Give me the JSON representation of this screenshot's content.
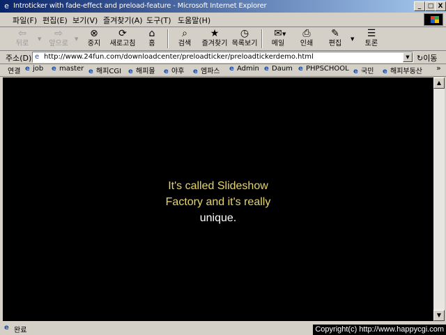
{
  "window": {
    "title": "Introticker with fade-effect and preload-feature - Microsoft Internet Explorer",
    "icon": "ie-icon",
    "minimize_label": "_",
    "maximize_label": "□",
    "close_label": "X"
  },
  "menu": [
    "파일(F)",
    "편집(E)",
    "보기(V)",
    "즐겨찾기(A)",
    "도구(T)",
    "도움말(H)"
  ],
  "toolbar": {
    "back": "뒤로",
    "forward": "앞으로",
    "stop": "중지",
    "refresh": "새로고침",
    "home": "홈",
    "search": "검색",
    "favorites": "즐겨찾기",
    "history": "목록보기",
    "mail": "메일",
    "print": "인쇄",
    "edit": "편집",
    "discuss": "토론"
  },
  "address": {
    "label": "주소(D)",
    "url": "http://www.24fun.com/downloadcenter/preloadticker/preloadtickerdemo.html",
    "go_label": "이동"
  },
  "links": {
    "label": "연결",
    "items": [
      "job",
      "master",
      "해피CGI",
      "해피몰",
      "야후",
      "엠파스",
      "Admin",
      "Daum",
      "PHPSCHOOL",
      "국민",
      "해피부동산"
    ],
    "more": "»"
  },
  "content": {
    "line1": "It's called Slideshow",
    "line2": "Factory and it's really",
    "line3": "unique."
  },
  "colors": {
    "title_start": "#0a246a",
    "title_end": "#a6caf0",
    "content_bg": "#000000",
    "text_yellow": "#e4d66a",
    "text_white": "#ffffff"
  },
  "status": {
    "text": "완료"
  },
  "watermark": "Copyright(c) http://www.happycgi.com"
}
